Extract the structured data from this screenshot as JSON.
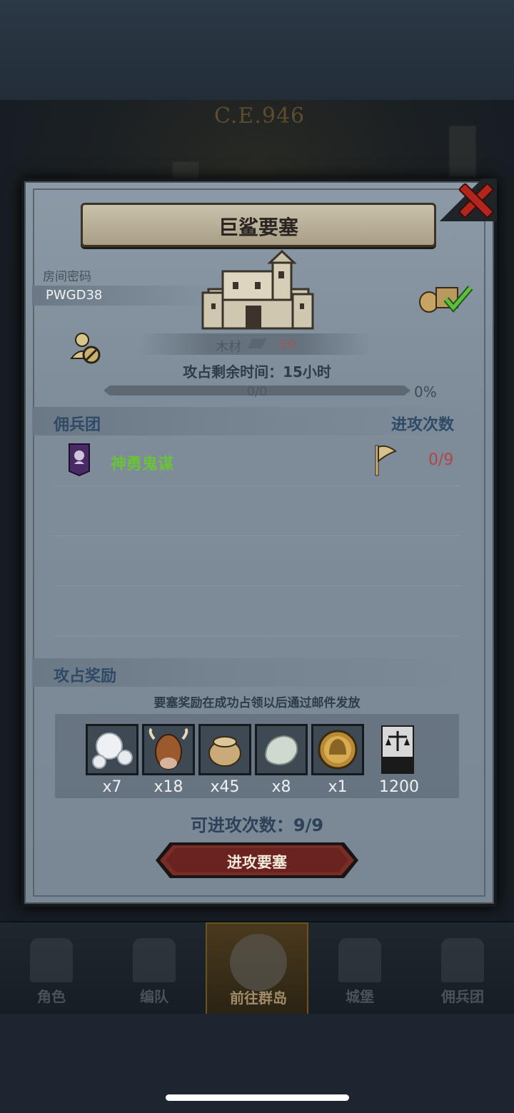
{
  "background": {
    "year_text": "C.E.946"
  },
  "dialog": {
    "title": "巨鲨要塞",
    "room": {
      "label": "房间密码",
      "code": "PWGD38"
    },
    "resource": {
      "label": "木材",
      "value": "-50"
    },
    "remaining_time": "攻占剩余时间：15小时",
    "progress": {
      "text": "0/0",
      "percent_label": "0%",
      "fraction": 0
    },
    "mercenary_section": {
      "title": "佣兵团",
      "right_header": "进攻次数",
      "rows": [
        {
          "name": "神勇鬼谋",
          "attacks": "0/9"
        }
      ]
    },
    "reward_section": {
      "title": "攻占奖励",
      "note": "要塞奖励在成功占领以后通过邮件发放",
      "items": [
        {
          "icon": "pearl-icon",
          "qty": "x7"
        },
        {
          "icon": "cow-icon",
          "qty": "x18"
        },
        {
          "icon": "grain-sack-icon",
          "qty": "x45"
        },
        {
          "icon": "stone-icon",
          "qty": "x8"
        },
        {
          "icon": "gold-helmet-coin-icon",
          "qty": "x1"
        },
        {
          "icon": "honor-banner-icon",
          "qty": "1200"
        }
      ]
    },
    "attempts_text": "可进攻次数：9/9",
    "attack_button": "进攻要塞"
  },
  "bottom_nav": [
    {
      "label": "角色",
      "icon": "knight-icon"
    },
    {
      "label": "编队",
      "icon": "squad-icon"
    },
    {
      "label": "前往群岛",
      "icon": "globe-icon",
      "active": true
    },
    {
      "label": "城堡",
      "icon": "castle-icon"
    },
    {
      "label": "佣兵团",
      "icon": "mercenary-icon"
    }
  ],
  "colors": {
    "accent_green": "#6cc13b",
    "warning_red": "#b24444",
    "close_red": "#b3261e",
    "button_red": "#7a2c26"
  }
}
